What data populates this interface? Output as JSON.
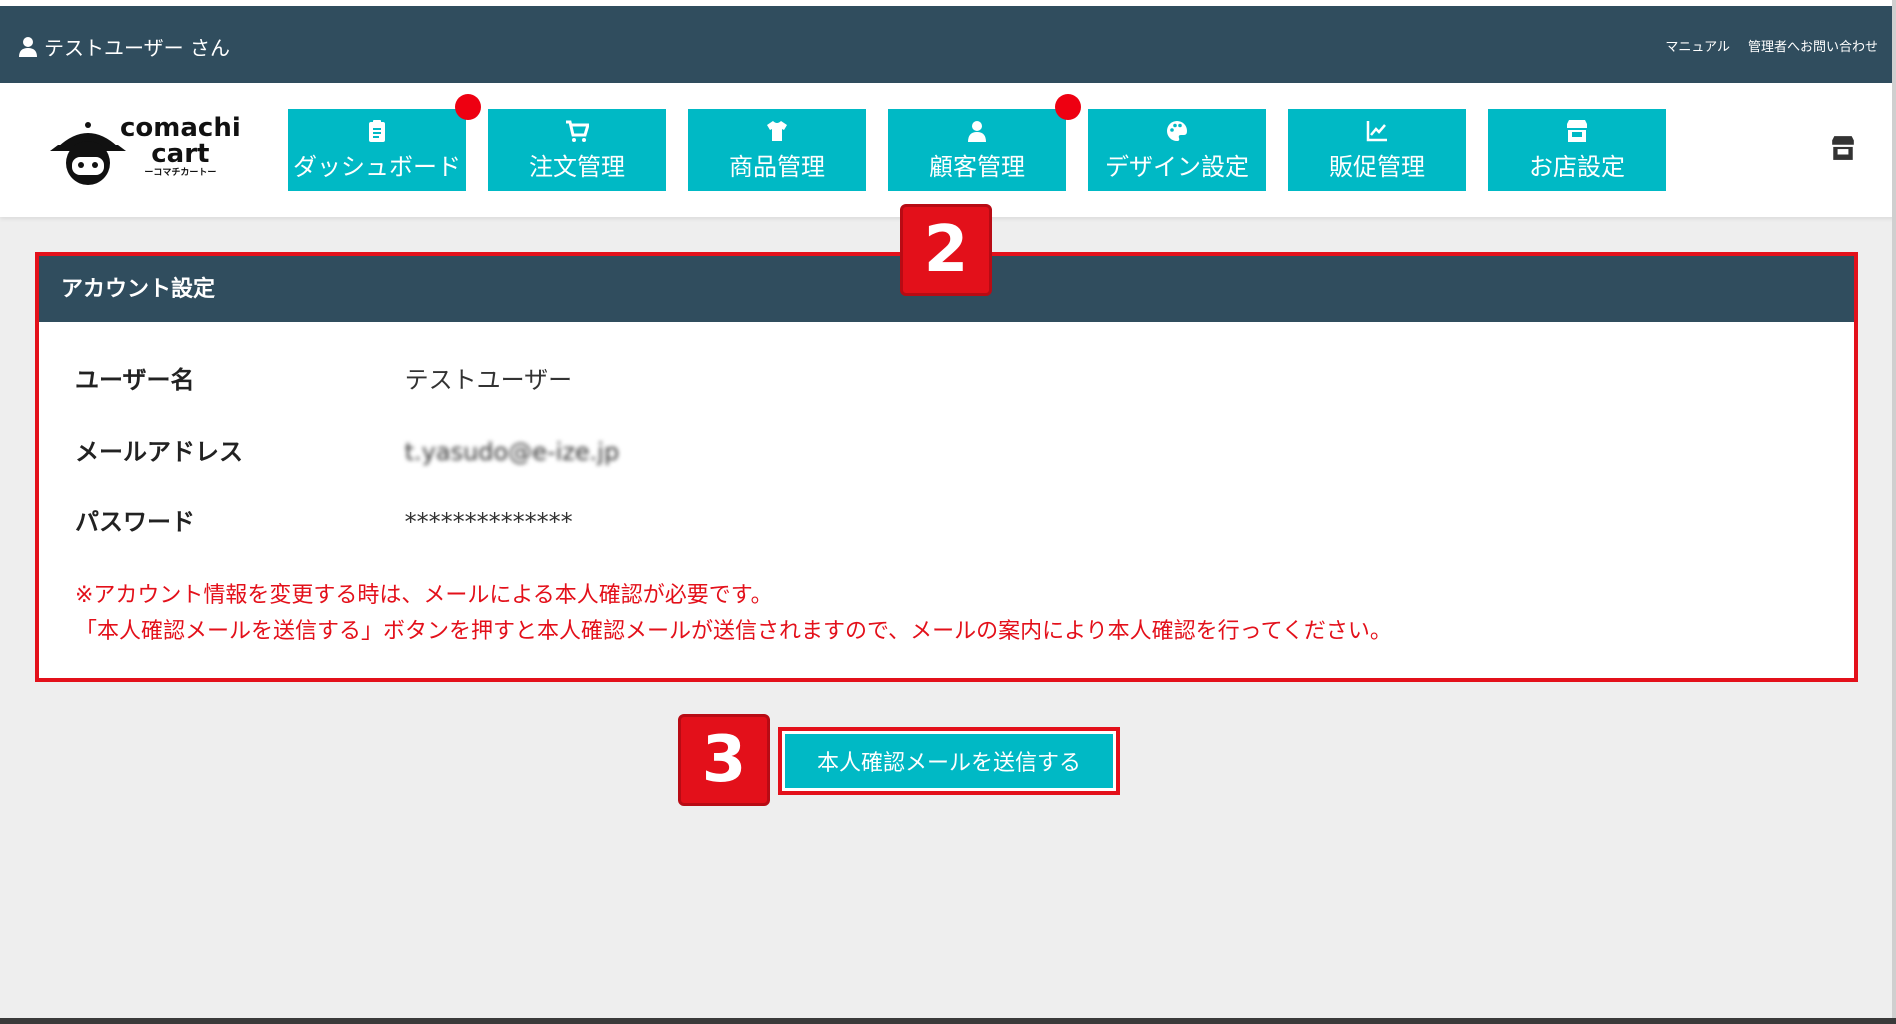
{
  "header": {
    "user_label": "テストユーザー さん",
    "links": [
      "マニュアル",
      "管理者へお問い合わせ"
    ]
  },
  "logo": {
    "line1": "comachi",
    "line2": "cart",
    "sub": "ーコマチカートー"
  },
  "nav": [
    {
      "label": "ダッシュボード",
      "icon": "clipboard-icon",
      "badge": true
    },
    {
      "label": "注文管理",
      "icon": "cart-icon",
      "badge": false
    },
    {
      "label": "商品管理",
      "icon": "shirt-icon",
      "badge": false
    },
    {
      "label": "顧客管理",
      "icon": "user-icon",
      "badge": true
    },
    {
      "label": "デザイン設定",
      "icon": "palette-icon",
      "badge": false
    },
    {
      "label": "販促管理",
      "icon": "chart-icon",
      "badge": false
    },
    {
      "label": "お店設定",
      "icon": "store-icon",
      "badge": false
    }
  ],
  "panel": {
    "title": "アカウント設定",
    "rows": [
      {
        "label": "ユーザー名",
        "value": "テストユーザー"
      },
      {
        "label": "メールアドレス",
        "value": "t.yasudo@e-ize.jp"
      },
      {
        "label": "パスワード",
        "value": "**************"
      }
    ],
    "notice": [
      "※アカウント情報を変更する時は、メールによる本人確認が必要です。",
      "「本人確認メールを送信する」ボタンを押すと本人確認メールが送信されますので、メールの案内により本人確認を行ってください。"
    ]
  },
  "send_button": {
    "label": "本人確認メールを送信する"
  },
  "steps": {
    "two": "2",
    "three": "3"
  },
  "colors": {
    "header": "#304d5e",
    "accent": "#00b9c5",
    "highlight": "#e3101a"
  }
}
